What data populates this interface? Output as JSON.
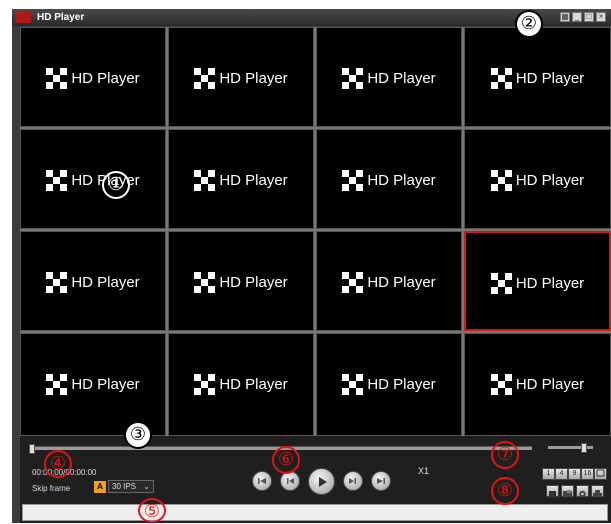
{
  "window": {
    "title": "HD Player",
    "icon": "app-icon",
    "controls": [
      "grid-layout-icon",
      "minimize-icon",
      "maximize-icon",
      "close-icon"
    ]
  },
  "grid": {
    "cell_label": "HD Player",
    "logo_icon": "hd-player-logo-icon",
    "cell_count": 16,
    "selected_cell": 11,
    "selected_color": "#d11a1a"
  },
  "controls": {
    "time": "00:00:00/00:00:00",
    "skip_label": "Skip frame",
    "auto_badge": "A",
    "fps_value": "30 IPS",
    "speed": "X1",
    "playback_buttons": [
      "previous-icon",
      "rewind-icon",
      "play-icon",
      "forward-icon",
      "next-icon"
    ],
    "layout_buttons": [
      "1",
      "4",
      "9",
      "16",
      "full"
    ],
    "tool_buttons": [
      "snapshot-icon",
      "open-file-icon",
      "settings-icon",
      "print-icon"
    ]
  },
  "callouts": {
    "c1": "①",
    "c2": "②",
    "c3": "③",
    "c4": "④",
    "c5": "⑤",
    "c6": "⑥",
    "c7": "⑦",
    "c8": "⑧"
  },
  "colors": {
    "frame": "#3b3b3b",
    "cell_bg": "#000000",
    "callout_red": "#e01414",
    "callout_black": "#000000"
  }
}
